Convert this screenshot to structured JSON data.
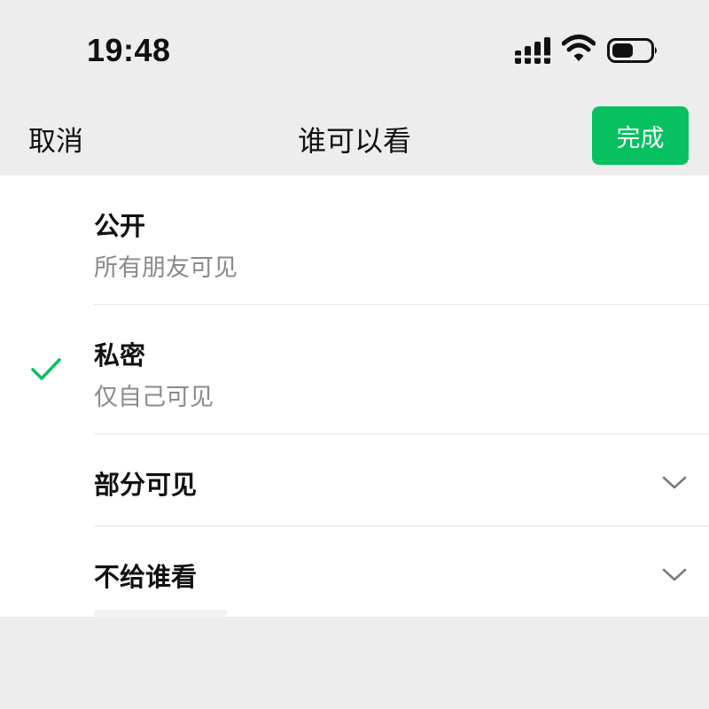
{
  "status_bar": {
    "time": "19:48",
    "icons": [
      "signal-icon",
      "wifi-icon",
      "battery-icon"
    ]
  },
  "nav": {
    "cancel_label": "取消",
    "title": "谁可以看",
    "done_label": "完成"
  },
  "options": [
    {
      "title": "公开",
      "description": "所有朋友可见",
      "selected": false,
      "expandable": false
    },
    {
      "title": "私密",
      "description": "仅自己可见",
      "selected": true,
      "expandable": false
    },
    {
      "title": "部分可见",
      "selected": false,
      "expandable": true
    },
    {
      "title": "不给谁看",
      "selected": false,
      "expandable": true
    }
  ],
  "colors": {
    "accent": "#07c160",
    "background": "#ededed",
    "list_background": "#ffffff",
    "secondary_text": "#8a8a8a",
    "divider": "#e5e5e5"
  }
}
